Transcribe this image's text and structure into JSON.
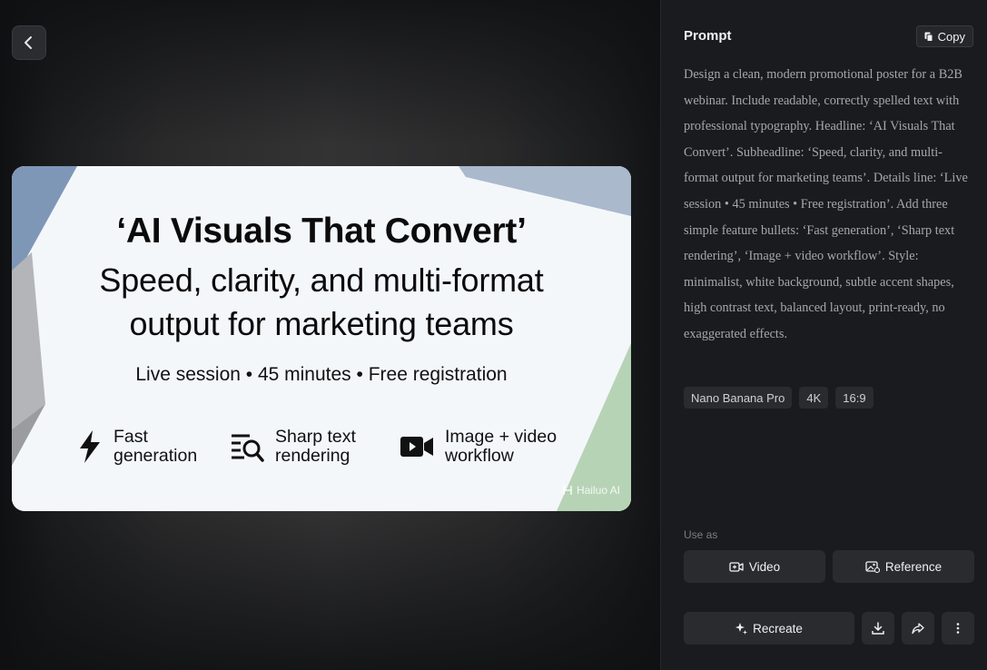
{
  "poster": {
    "headline": "‘AI Visuals That Convert’",
    "subheadline_line1": "Speed, clarity, and multi-format",
    "subheadline_line2": "output for marketing teams",
    "details": "Live session • 45 minutes • Free registration",
    "features": [
      {
        "label_line1": "Fast",
        "label_line2": "generation",
        "icon": "lightning-icon"
      },
      {
        "label_line1": "Sharp text",
        "label_line2": "rendering",
        "icon": "text-search-icon"
      },
      {
        "label_line1": "Image + video",
        "label_line2": "workflow",
        "icon": "video-camera-icon"
      }
    ],
    "watermark": "Hailuo AI",
    "colors": {
      "background": "#f4f7fa",
      "accent_blue": "#7f97b7",
      "accent_green": "#b7d3b6",
      "text": "#0b0b0c"
    }
  },
  "panel": {
    "title": "Prompt",
    "copy_label": "Copy",
    "prompt": "Design a clean, modern promotional poster for a B2B webinar. Include readable, correctly spelled text with professional typography. Headline: ‘AI Visuals That Convert’. Subheadline: ‘Speed, clarity, and multi-format output for marketing teams’. Details line: ‘Live session • 45 minutes • Free registration’. Add three simple feature bullets: ‘Fast generation’, ‘Sharp text rendering’, ‘Image + video workflow’. Style: minimalist, white background, subtle accent shapes, high contrast text, balanced layout, print-ready, no exaggerated effects.",
    "tags": [
      "Nano Banana Pro",
      "4K",
      "16:9"
    ],
    "use_as_label": "Use as",
    "video_label": "Video",
    "reference_label": "Reference",
    "recreate_label": "Recreate"
  }
}
